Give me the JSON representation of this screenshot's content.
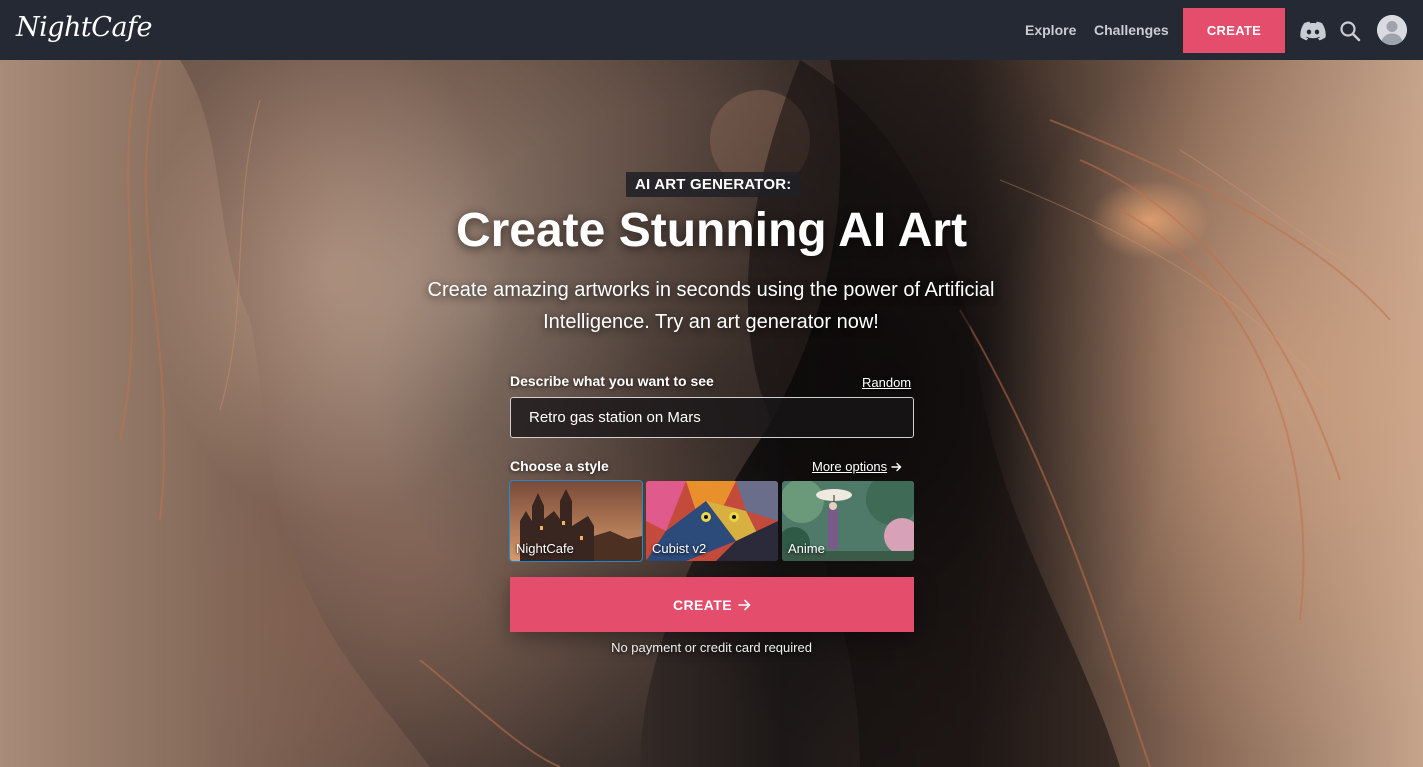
{
  "header": {
    "logo_text": "NightCafe",
    "nav": {
      "explore": "Explore",
      "challenges": "Challenges",
      "create": "CREATE"
    },
    "icons": [
      "discord-icon",
      "search-icon",
      "avatar"
    ]
  },
  "hero": {
    "eyebrow": "AI ART GENERATOR:",
    "title": "Create Stunning AI Art",
    "subtitle": "Create amazing artworks in seconds using the power of Artificial Intelligence. Try an art generator now!"
  },
  "form": {
    "describe_label": "Describe what you want to see",
    "random_link": "Random",
    "prompt_value": "Retro gas station on Mars",
    "style_label": "Choose a style",
    "more_options_link": "More options",
    "styles": [
      {
        "label": "NightCafe",
        "selected": true
      },
      {
        "label": "Cubist v2",
        "selected": false
      },
      {
        "label": "Anime",
        "selected": false
      }
    ],
    "create_button": "CREATE",
    "disclaimer": "No payment or credit card required"
  },
  "colors": {
    "accent": "#e54d6c",
    "header_bg": "#252933",
    "selected_outline": "#1f8ad6"
  }
}
